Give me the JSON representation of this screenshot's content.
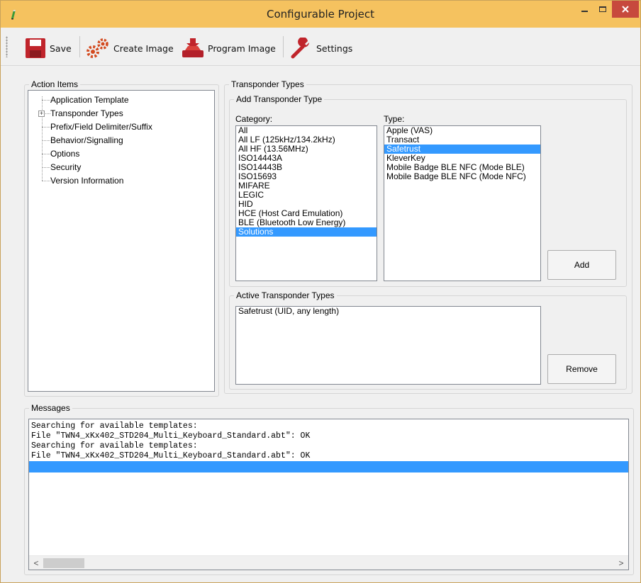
{
  "window": {
    "title": "Configurable Project",
    "accent": "#f5c25f",
    "close_color": "#c7493d"
  },
  "toolbar": {
    "save_label": "Save",
    "create_image_label": "Create Image",
    "program_image_label": "Program Image",
    "settings_label": "Settings"
  },
  "action_items": {
    "legend": "Action Items",
    "items": [
      "Application Template",
      "Transponder Types",
      "Prefix/Field Delimiter/Suffix",
      "Behavior/Signalling",
      "Options",
      "Security",
      "Version Information"
    ],
    "expander": "+"
  },
  "transponder_types": {
    "legend": "Transponder Types",
    "add_group": {
      "legend": "Add Transponder Type",
      "category_label": "Category:",
      "type_label": "Type:",
      "categories": [
        "All",
        "All LF (125kHz/134.2kHz)",
        "All HF (13.56MHz)",
        "ISO14443A",
        "ISO14443B",
        "ISO15693",
        "MIFARE",
        "LEGIC",
        "HID",
        "HCE (Host Card Emulation)",
        "BLE (Bluetooth Low Energy)",
        "Solutions"
      ],
      "selected_category": "Solutions",
      "types": [
        "Apple (VAS)",
        "Transact",
        "Safetrust",
        "KleverKey",
        "Mobile Badge BLE NFC (Mode BLE)",
        "Mobile Badge BLE NFC (Mode NFC)"
      ],
      "selected_type": "Safetrust",
      "add_label": "Add"
    },
    "active_group": {
      "legend": "Active Transponder Types",
      "items": [
        "Safetrust (UID, any length)"
      ],
      "remove_label": "Remove"
    }
  },
  "messages": {
    "legend": "Messages",
    "lines": [
      "Searching for available templates:",
      "File \"TWN4_xKx402_STD204_Multi_Keyboard_Standard.abt\": OK",
      "Searching for available templates:",
      "File \"TWN4_xKx402_STD204_Multi_Keyboard_Standard.abt\": OK",
      ""
    ],
    "selected_index": 4,
    "scroll_left": "<",
    "scroll_right": ">"
  },
  "colors": {
    "selection": "#3399ff"
  }
}
